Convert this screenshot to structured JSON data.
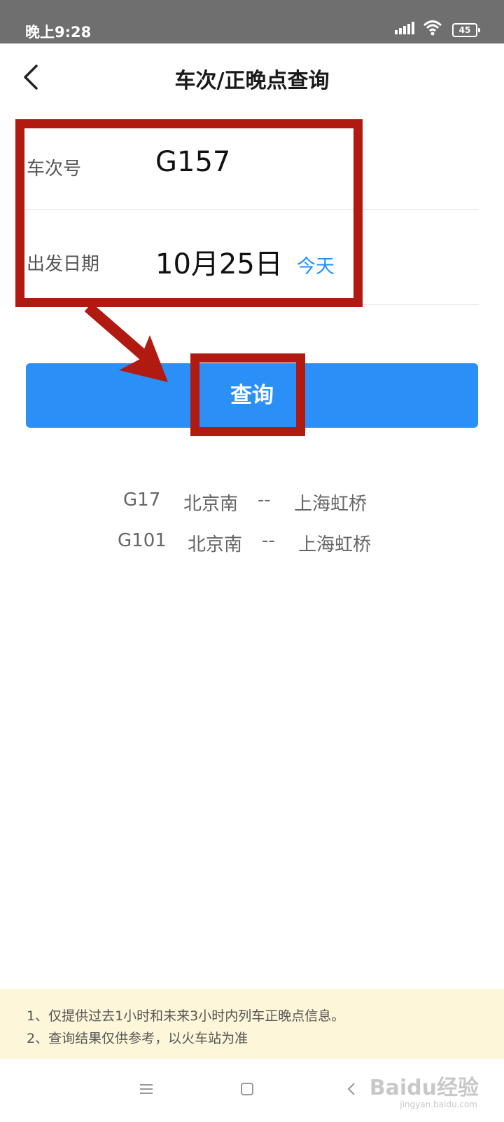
{
  "status_bar": {
    "time": "晚上9:28",
    "battery": "45",
    "icons": [
      "signal-icon",
      "wifi-icon",
      "battery-icon"
    ]
  },
  "header": {
    "back_icon": "chevron-left-icon",
    "title": "车次/正晚点查询"
  },
  "form": {
    "train_label": "车次号",
    "train_value": "G157",
    "date_label": "出发日期",
    "date_value": "10月25日",
    "today_link": "今天"
  },
  "query_button": "查询",
  "history": [
    {
      "train": "G17",
      "from": "北京南",
      "sep": "--",
      "to": "上海虹桥"
    },
    {
      "train": "G101",
      "from": "北京南",
      "sep": "--",
      "to": "上海虹桥"
    }
  ],
  "notice": {
    "line1": "1、仅提供过去1小时和未来3小时内列车正晚点信息。",
    "line2": "2、查询结果仅供参考，以火车站为准"
  },
  "system_nav": {
    "icons": [
      "menu-icon",
      "home-icon",
      "back-icon"
    ]
  },
  "watermark": {
    "logo": "Baidu经验",
    "url": "jingyan.baidu.com"
  },
  "colors": {
    "accent": "#2b8ff8",
    "highlight": "#b11a10",
    "notice_bg": "#fdf6d9",
    "statusbar_bg": "#6f6f6f"
  }
}
